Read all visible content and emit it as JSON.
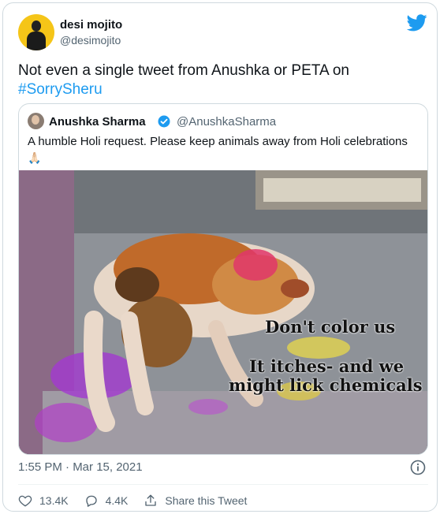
{
  "author": {
    "display_name": "desi mojito",
    "handle": "@desimojito"
  },
  "tweet": {
    "text": "Not even a single tweet from Anushka or PETA on",
    "hashtag": "#SorrySheru",
    "timestamp": "1:55 PM · Mar 15, 2021"
  },
  "quoted_tweet": {
    "display_name": "Anushka Sharma",
    "handle": "@AnushkaSharma",
    "text": "A humble Holi request. Please keep animals away from Holi celebrations",
    "emoji": "🙏🏻",
    "image_caption": {
      "line1": "Don't color us",
      "line2": "It itches- and we",
      "line3": "might lick chemicals"
    }
  },
  "actions": {
    "likes": "13.4K",
    "replies": "4.4K",
    "share_label": "Share this Tweet"
  },
  "colors": {
    "accent": "#1d9bf0",
    "secondary_text": "#536471",
    "border": "#cfd9de"
  },
  "icons": {
    "brand": "twitter-bird-icon",
    "verified": "verified-badge-icon",
    "info": "info-icon",
    "like": "heart-icon",
    "reply": "reply-icon",
    "share": "share-icon"
  }
}
